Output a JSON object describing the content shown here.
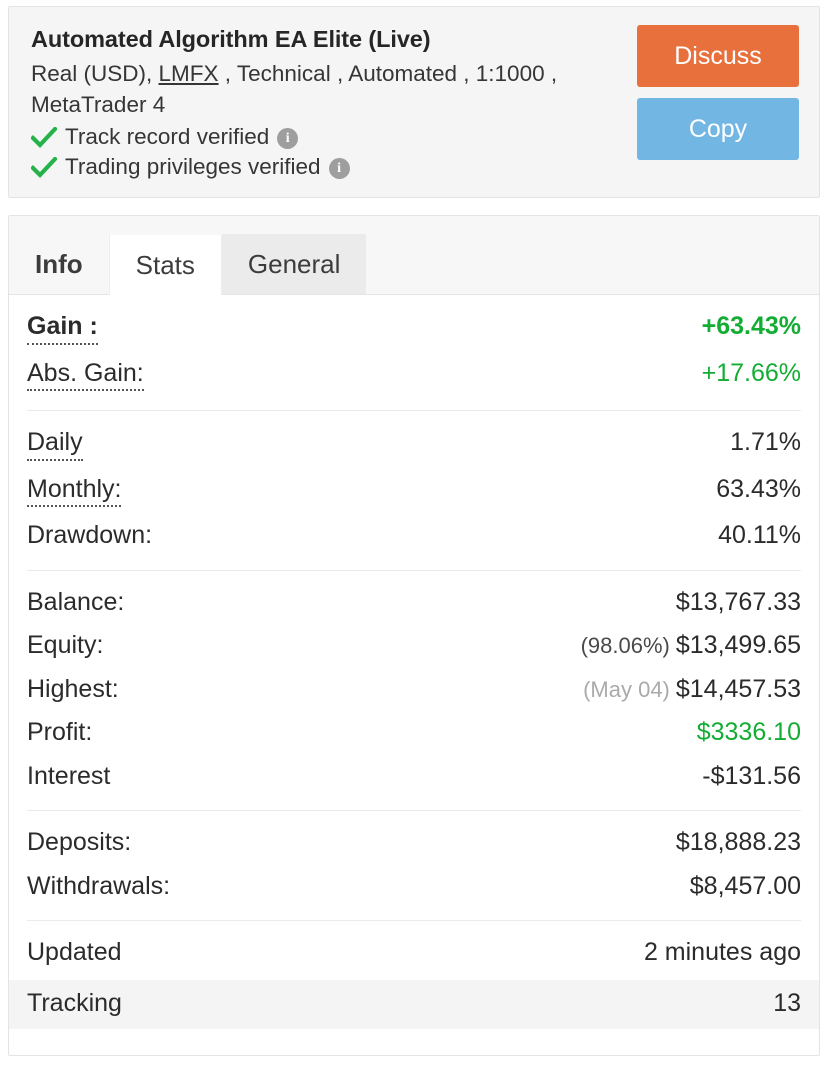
{
  "header": {
    "account_title": "Automated Algorithm EA Elite (Live)",
    "meta_prefix": "Real (USD), ",
    "broker": "LMFX",
    "meta_suffix": " , Technical , Automated , 1:1000 , MetaTrader 4",
    "verifications": [
      {
        "label": "Track record verified",
        "icon": "check-icon",
        "info": "i"
      },
      {
        "label": "Trading privileges verified",
        "icon": "check-icon",
        "info": "i"
      }
    ],
    "buttons": {
      "discuss": "Discuss",
      "copy": "Copy"
    },
    "colors": {
      "discuss_bg": "#e8703c",
      "copy_bg": "#72b6e3",
      "check_green": "#26b24b",
      "info_badge_bg": "#9e9e9e"
    }
  },
  "tabs": [
    {
      "label": "Info",
      "active": false
    },
    {
      "label": "Stats",
      "active": true
    },
    {
      "label": "General",
      "active": false
    }
  ],
  "stats": {
    "group_gain": [
      {
        "label": "Gain :",
        "value": "+63.43%"
      },
      {
        "label": "Abs. Gain:",
        "value": "+17.66%"
      }
    ],
    "group_rates": [
      {
        "label": "Daily",
        "value": "1.71%"
      },
      {
        "label": "Monthly:",
        "value": "63.43%"
      },
      {
        "label": "Drawdown:",
        "value": "40.11%"
      }
    ],
    "group_money": [
      {
        "label": "Balance:",
        "note": "",
        "value": "$13,767.33"
      },
      {
        "label": "Equity:",
        "note": "(98.06%)",
        "value": "$13,499.65"
      },
      {
        "label": "Highest:",
        "note": "(May 04)",
        "value": "$14,457.53"
      },
      {
        "label": "Profit:",
        "note": "",
        "value": "$3336.10"
      },
      {
        "label": "Interest",
        "note": "",
        "value": "-$131.56"
      }
    ],
    "group_flows": [
      {
        "label": "Deposits:",
        "value": "$18,888.23"
      },
      {
        "label": "Withdrawals:",
        "value": "$8,457.00"
      }
    ],
    "group_meta": {
      "updated_label": "Updated",
      "updated_value": "2 minutes ago",
      "tracking_label": "Tracking",
      "tracking_value": "13"
    },
    "colors": {
      "positive_green": "#14ad34",
      "note_light": "#aaaaaa"
    }
  }
}
